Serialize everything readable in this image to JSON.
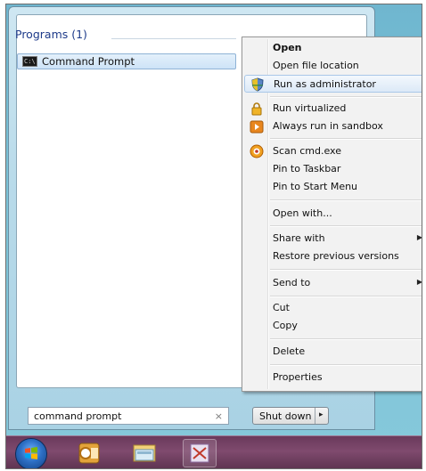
{
  "start_menu": {
    "programs_header": "Programs (1)",
    "result_label": "Command Prompt",
    "result_icon_text": "C:\\",
    "search_value": "command prompt",
    "clear_glyph": "×",
    "shutdown_label": "Shut down",
    "shutdown_arrow": "▸"
  },
  "context_menu": {
    "items": [
      {
        "label": "Open",
        "icon": null
      },
      {
        "label": "Open file location",
        "icon": null
      },
      {
        "label": "Run as administrator",
        "icon": "uac-shield-icon"
      },
      {
        "label": "Run virtualized",
        "icon": "lock-icon"
      },
      {
        "label": "Always run in sandbox",
        "icon": "sandbox-icon"
      },
      {
        "label": "Scan cmd.exe",
        "icon": "antivirus-scan-icon"
      },
      {
        "label": "Pin to Taskbar",
        "icon": null
      },
      {
        "label": "Pin to Start Menu",
        "icon": null
      },
      {
        "label": "Open with...",
        "icon": null
      },
      {
        "label": "Share with",
        "icon": null,
        "submenu": true
      },
      {
        "label": "Restore previous versions",
        "icon": null
      },
      {
        "label": "Send to",
        "icon": null,
        "submenu": true
      },
      {
        "label": "Cut",
        "icon": null
      },
      {
        "label": "Copy",
        "icon": null
      },
      {
        "label": "Delete",
        "icon": null
      },
      {
        "label": "Properties",
        "icon": null
      }
    ],
    "submenu_arrow": "▶"
  },
  "taskbar": {
    "items": [
      "start-orb-icon",
      "outlook-icon",
      "windows-explorer-icon",
      "snipping-tool-icon"
    ]
  },
  "colors": {
    "taskbar": "#7f4a6e",
    "hover": "#dce9f7",
    "programs_header": "#1e3b8a"
  }
}
